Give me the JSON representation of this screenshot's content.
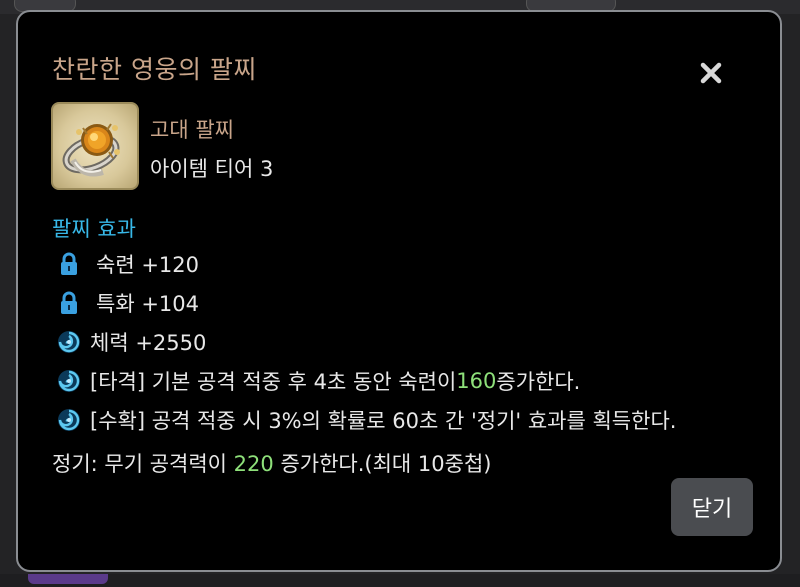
{
  "dialog": {
    "title": "찬란한 영웅의 팔찌",
    "close_icon": "close-x-icon"
  },
  "item": {
    "icon": "bracelet-item-icon",
    "grade": "고대 팔찌",
    "tier": "아이템 티어 3"
  },
  "effects": {
    "section_title": "팔찌 효과",
    "rows": [
      {
        "icon": "lock-icon",
        "parts": [
          "숙련 +120"
        ]
      },
      {
        "icon": "lock-icon",
        "parts": [
          "특화 +104"
        ]
      },
      {
        "icon": "swirl-effect-icon",
        "parts": [
          "체력 +2550"
        ]
      },
      {
        "icon": "swirl-effect-icon",
        "parts": [
          "[타격] 기본 공격 적중 후 4초 동안 숙련이 ",
          "160",
          " 증가한다."
        ]
      },
      {
        "icon": "swirl-effect-icon",
        "parts": [
          "[수확] 공격 적중 시 3%의 확률로 60초 간 '정기' 효과를 획득한다."
        ]
      }
    ],
    "jeonggi_parts": [
      "정기: 무기 공격력이 ",
      "220",
      " 증가한다.(최대 10중첩)"
    ]
  },
  "footer": {
    "close_button_label": "닫기"
  },
  "colors": {
    "title": "#c9a58a",
    "section": "#38b8e8",
    "highlight": "#8ee07a",
    "text": "#e8e8e8",
    "border": "#8a8d92"
  }
}
